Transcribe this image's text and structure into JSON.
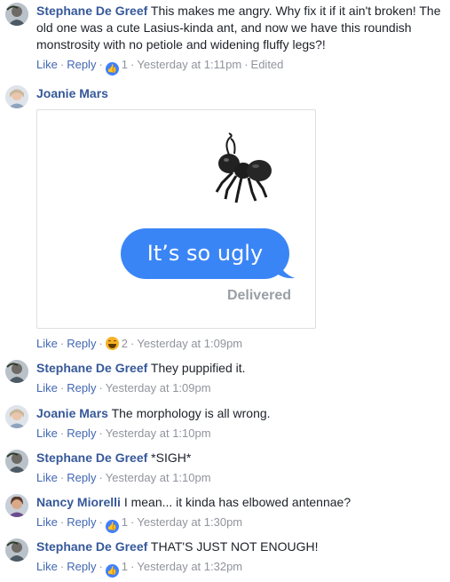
{
  "common": {
    "like_label": "Like",
    "reply_label": "Reply",
    "separator": "·"
  },
  "comments": [
    {
      "author": "Stephane De Greef",
      "text": "This makes me angry. Why fix it if it ain't broken! The old one was a cute Lasius-kinda ant, and now we have this roundish monstrosity with no petiole and widening fluffy legs?!",
      "reaction_icon": "like-icon",
      "reaction_count": "1",
      "timestamp": "Yesterday at 1:11pm",
      "edited_label": "Edited"
    },
    {
      "author": "Joanie Mars",
      "sticker": {
        "bubble_text": "It’s so ugly",
        "status_text": "Delivered"
      },
      "reaction_icon": "haha-icon",
      "reaction_count": "2",
      "timestamp": "Yesterday at 1:09pm"
    },
    {
      "author": "Stephane De Greef",
      "text": "They puppified it.",
      "timestamp": "Yesterday at 1:09pm"
    },
    {
      "author": "Joanie Mars",
      "text": "The morphology is all wrong.",
      "timestamp": "Yesterday at 1:10pm"
    },
    {
      "author": "Stephane De Greef",
      "text": "*SIGH*",
      "timestamp": "Yesterday at 1:10pm"
    },
    {
      "author": "Nancy Miorelli",
      "text": "I mean... it kinda has elbowed antennae?",
      "reaction_icon": "like-icon",
      "reaction_count": "1",
      "timestamp": "Yesterday at 1:30pm"
    },
    {
      "author": "Stephane De Greef",
      "text": "THAT'S JUST NOT ENOUGH!",
      "reaction_icon": "like-icon",
      "reaction_count": "1",
      "timestamp": "Yesterday at 1:32pm"
    }
  ],
  "colors": {
    "author_link": "#365899",
    "action_link": "#4267b2",
    "meta_text": "#90949c",
    "bubble_blue": "#3a85f6",
    "like_blue": "#4080ff",
    "haha_yellow": "#f7b125"
  }
}
